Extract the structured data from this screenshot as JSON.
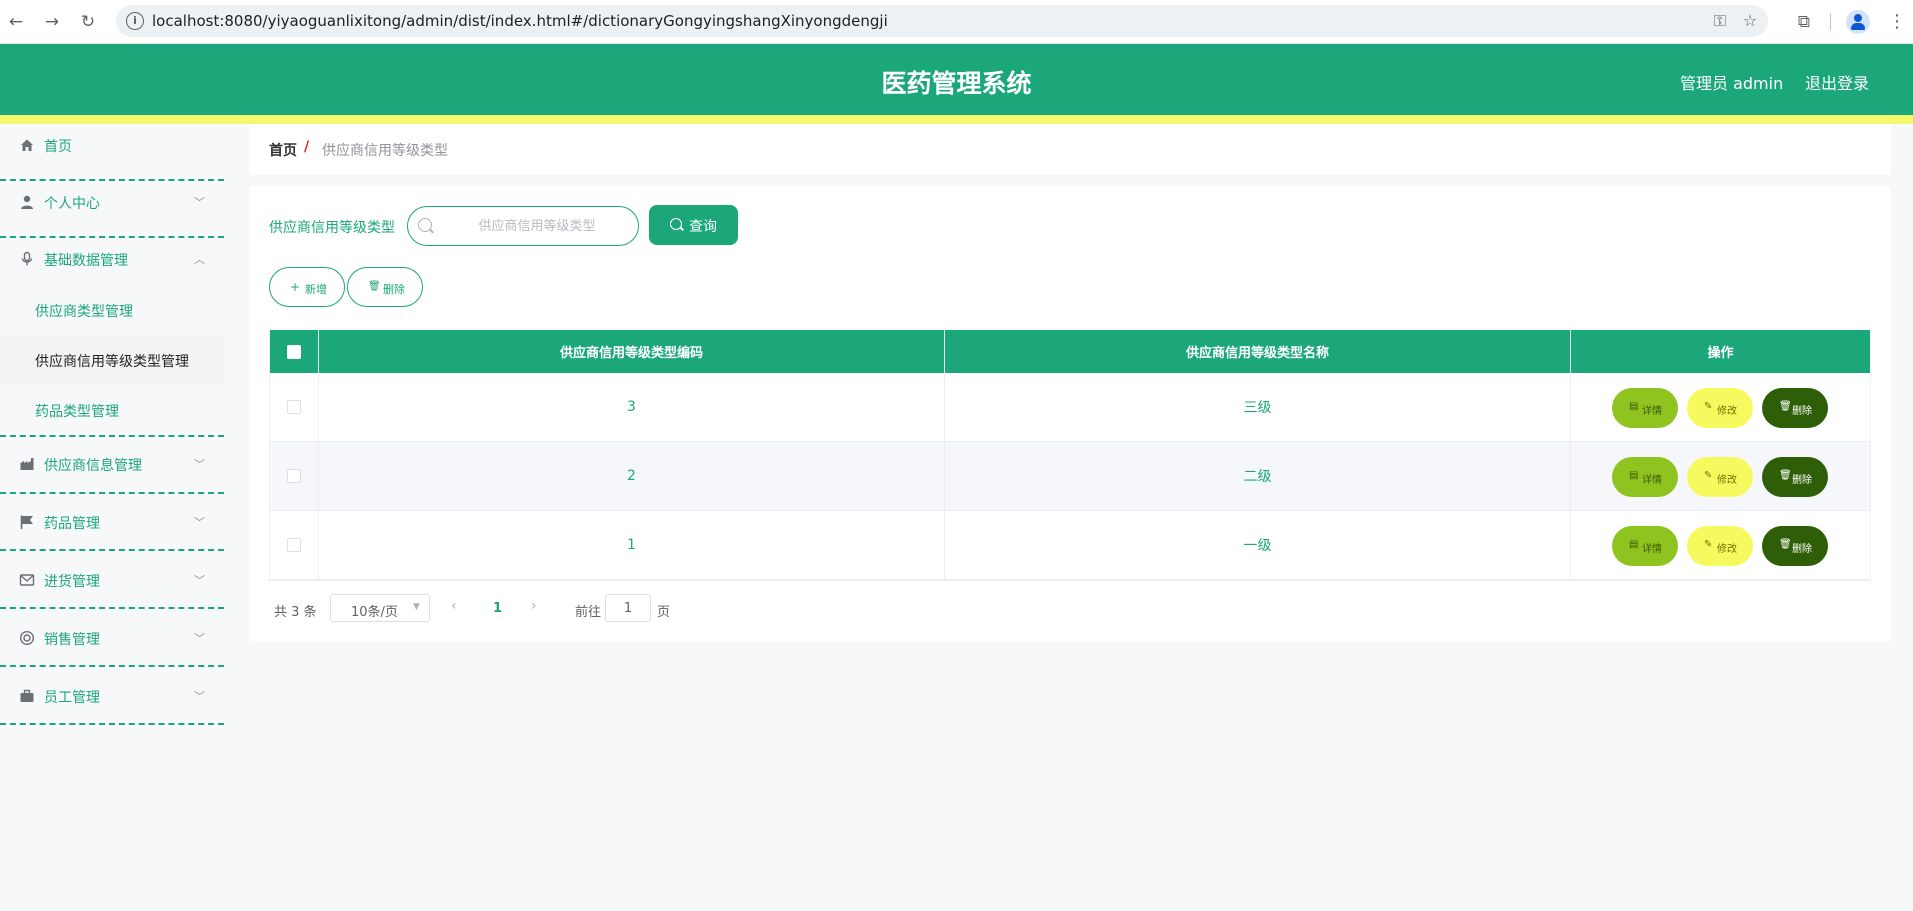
{
  "browser": {
    "url_host": "localhost:8080/yiyaoguanlixitong/admin/dist/index.html#/",
    "url_path": "dictionaryGongyingshangXinyongdengji",
    "icons": [
      "back-icon",
      "forward-icon",
      "reload-icon",
      "site-info-icon",
      "key-icon",
      "star-icon",
      "extensions-icon",
      "profile-icon",
      "menu-icon"
    ]
  },
  "header": {
    "title": "医药管理系统",
    "admin_label": "管理员 admin",
    "logout_label": "退出登录",
    "accent_color": "#1ba779",
    "stripe_color": "#f5f86f"
  },
  "sidebar": {
    "items": [
      {
        "label": "首页",
        "icon": "home-icon"
      },
      {
        "label": "个人中心",
        "icon": "user-icon"
      },
      {
        "label": "基础数据管理",
        "icon": "microphone-icon"
      },
      {
        "label": "供应商信息管理",
        "icon": "supplier-icon"
      },
      {
        "label": "药品管理",
        "icon": "flag-icon"
      },
      {
        "label": "进货管理",
        "icon": "mail-icon"
      },
      {
        "label": "销售管理",
        "icon": "lifebuoy-icon"
      },
      {
        "label": "员工管理",
        "icon": "briefcase-icon"
      }
    ],
    "submenu": [
      {
        "label": "供应商类型管理"
      },
      {
        "label": "供应商信用等级类型管理",
        "active": true
      },
      {
        "label": "药品类型管理"
      }
    ]
  },
  "breadcrumb": {
    "home": "首页",
    "separator": "/",
    "current": "供应商信用等级类型"
  },
  "search": {
    "label": "供应商信用等级类型",
    "placeholder": "供应商信用等级类型",
    "button": "查询"
  },
  "actions": {
    "add": "新增",
    "delete": "删除"
  },
  "table": {
    "columns": [
      "供应商信用等级类型编码",
      "供应商信用等级类型名称",
      "操作"
    ],
    "rows": [
      {
        "code": "3",
        "name": "三级"
      },
      {
        "code": "2",
        "name": "二级"
      },
      {
        "code": "1",
        "name": "一级"
      }
    ],
    "row_actions": {
      "detail": "详情",
      "edit": "修改",
      "delete": "删除"
    }
  },
  "pagination": {
    "total": "共 3 条",
    "page_size": "10条/页",
    "current_page": "1",
    "goto_label": "前往",
    "goto_value": "1",
    "page_suffix": "页"
  }
}
